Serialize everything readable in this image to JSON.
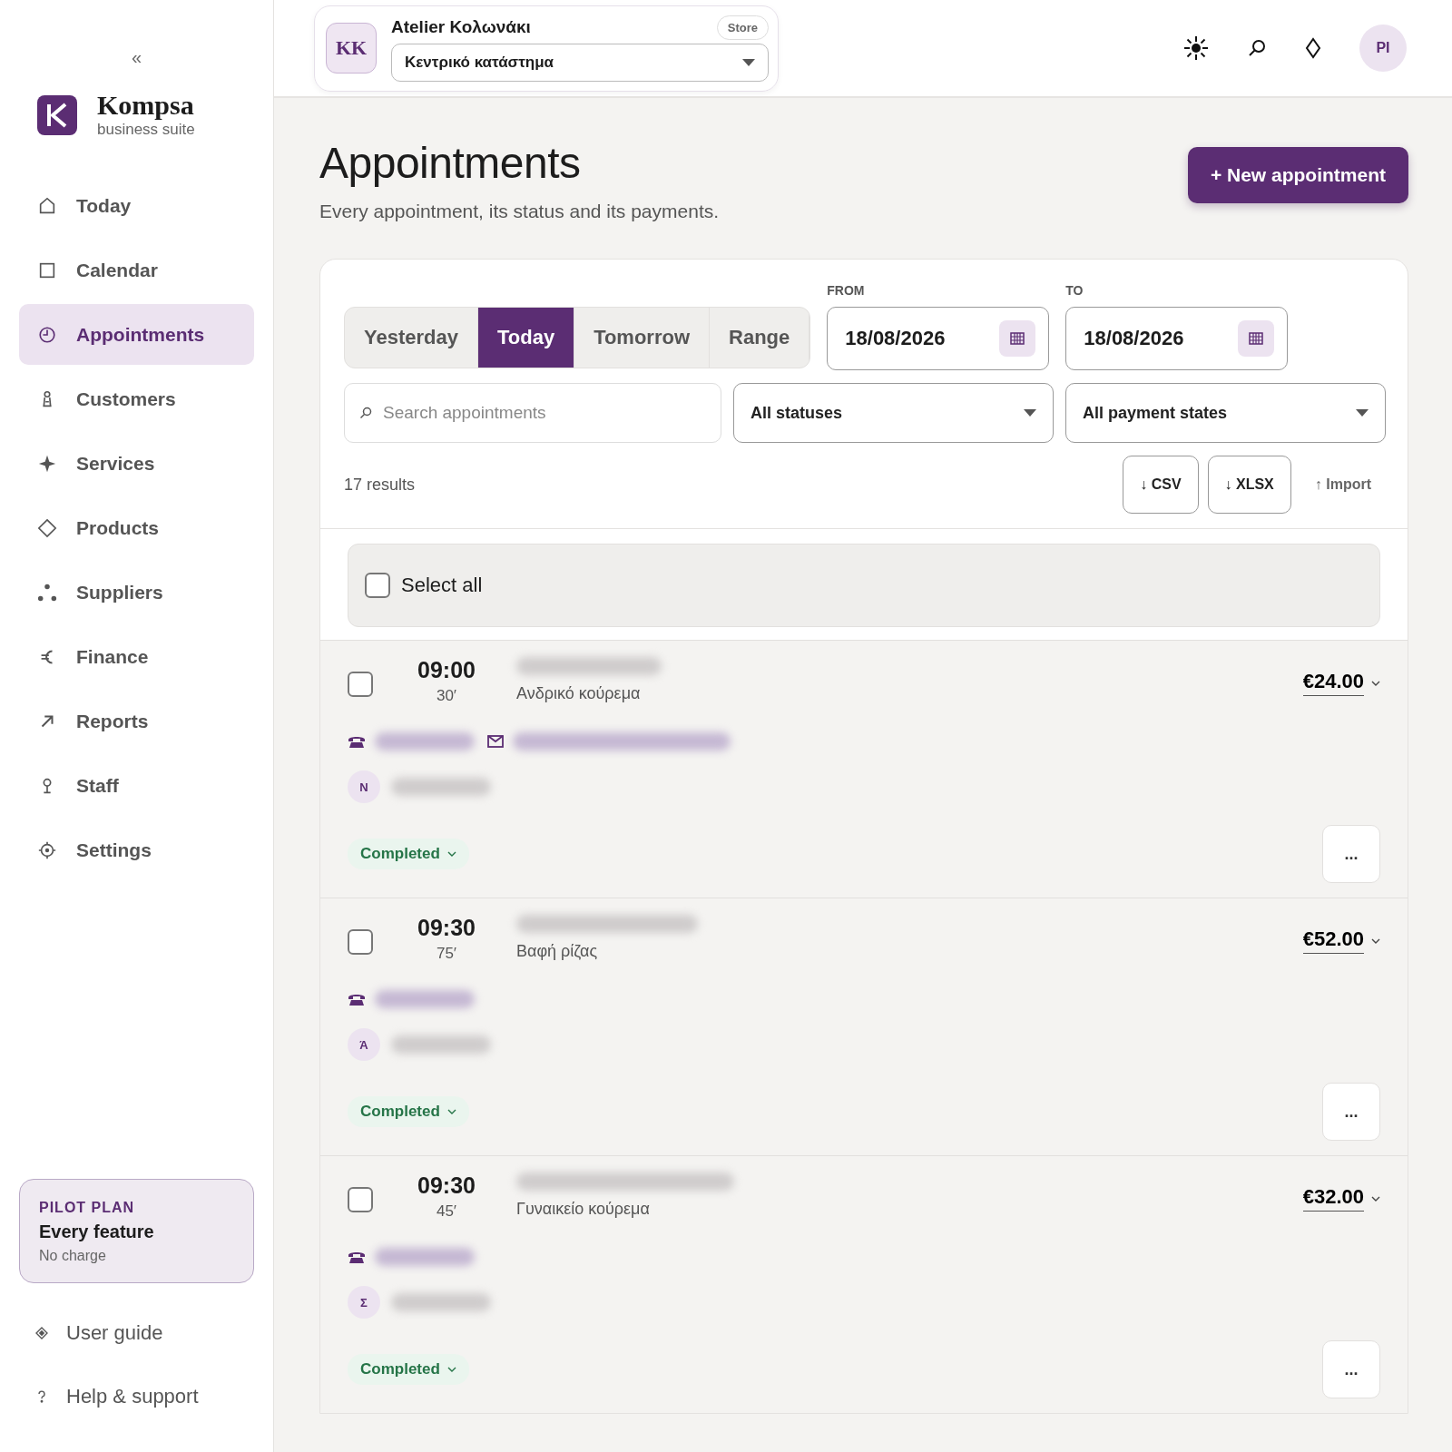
{
  "sidebar": {
    "collapse": "«",
    "brand": {
      "name": "Kompsa",
      "tagline": "business suite"
    },
    "items": [
      {
        "label": "Today",
        "kind": "home",
        "selected": false
      },
      {
        "label": "Calendar",
        "kind": "calendar",
        "selected": false
      },
      {
        "label": "Appointments",
        "kind": "appointments",
        "selected": true
      },
      {
        "label": "Customers",
        "kind": "customers",
        "selected": false
      },
      {
        "label": "Services",
        "kind": "services",
        "selected": false
      },
      {
        "label": "Products",
        "kind": "products",
        "selected": false
      },
      {
        "label": "Suppliers",
        "kind": "suppliers",
        "selected": false
      },
      {
        "label": "Finance",
        "kind": "finance",
        "selected": false
      },
      {
        "label": "Reports",
        "kind": "reports",
        "selected": false
      },
      {
        "label": "Staff",
        "kind": "staff",
        "selected": false
      },
      {
        "label": "Settings",
        "kind": "settings",
        "selected": false
      }
    ],
    "plan": {
      "eyebrow": "PILOT PLAN",
      "title": "Every feature",
      "note": "No charge"
    },
    "footer": [
      {
        "label": "User guide",
        "kind": "guide"
      },
      {
        "label": "Help & support",
        "kind": "help"
      }
    ]
  },
  "topbar": {
    "store": {
      "initials": "KK",
      "name": "Atelier Κολωνάκι",
      "badge": "Store",
      "branch": "Κεντρικό κατάστημα"
    },
    "avatar": "PI"
  },
  "page": {
    "title": "Appointments",
    "subtitle": "Every appointment, its status and its payments.",
    "new_button": "+ New appointment"
  },
  "filters": {
    "tabs": [
      {
        "label": "Yesterday",
        "selected": false
      },
      {
        "label": "Today",
        "selected": true
      },
      {
        "label": "Tomorrow",
        "selected": false
      },
      {
        "label": "Range",
        "selected": false
      }
    ],
    "from": {
      "label": "FROM",
      "value": "18/08/2026"
    },
    "to": {
      "label": "TO",
      "value": "18/08/2026"
    },
    "search": {
      "placeholder": "Search appointments"
    },
    "status": "All statuses",
    "payment": "All payment states",
    "results": "17 results",
    "exports": [
      "↓ CSV",
      "↓ XLSX"
    ],
    "import": "↑ Import"
  },
  "select_all": {
    "label": "Select all",
    "checked": false
  },
  "appointments": [
    {
      "checked": false,
      "time": "09:00",
      "duration": "30′",
      "service": "Ανδρικό κούρεμα",
      "price": "€24.00",
      "contacts": [
        {
          "kind": "phone"
        },
        {
          "kind": "email"
        }
      ],
      "staff_initial": "N",
      "status": {
        "label": "Completed",
        "kind": "completed"
      },
      "more": "..."
    },
    {
      "checked": false,
      "time": "09:30",
      "duration": "75′",
      "service": "Βαφή ρίζας",
      "price": "€52.00",
      "contacts": [
        {
          "kind": "phone"
        }
      ],
      "staff_initial": "Ά",
      "status": {
        "label": "Completed",
        "kind": "completed"
      },
      "more": "..."
    },
    {
      "checked": false,
      "time": "09:30",
      "duration": "45′",
      "service": "Γυναικείο κούρεμα",
      "price": "€32.00",
      "contacts": [
        {
          "kind": "phone"
        }
      ],
      "staff_initial": "Σ",
      "status": {
        "label": "Completed",
        "kind": "completed"
      },
      "more": "..."
    }
  ]
}
